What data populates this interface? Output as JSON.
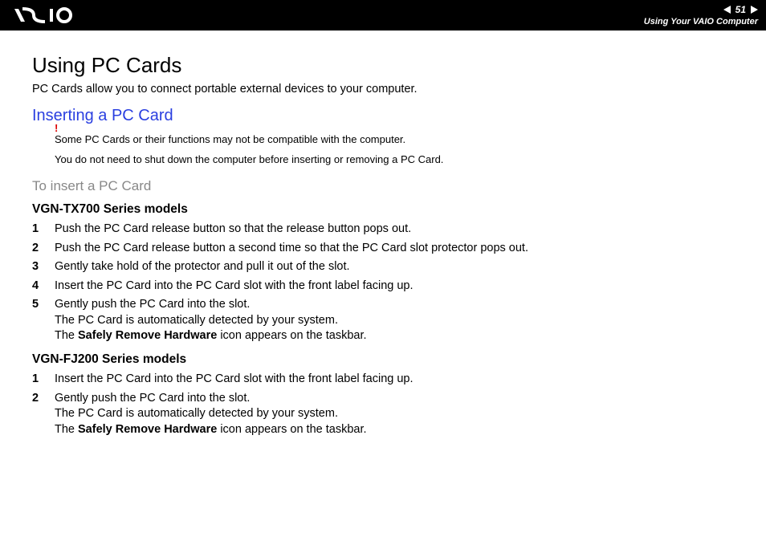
{
  "header": {
    "page_num": "51",
    "section": "Using Your VAIO Computer"
  },
  "title": "Using PC Cards",
  "intro": "PC Cards allow you to connect portable external devices to your computer.",
  "subtitle": "Inserting a PC Card",
  "note1": "Some PC Cards or their functions may not be compatible with the computer.",
  "note2": "You do not need to shut down the computer before inserting or removing a PC Card.",
  "procedure_title": "To insert a PC Card",
  "series1": {
    "name": "VGN-TX700 Series models",
    "steps": [
      "Push the PC Card release button so that the release button pops out.",
      "Push the PC Card release button a second time so that the PC Card slot protector pops out.",
      "Gently take hold of the protector and pull it out of the slot.",
      "Insert the PC Card into the PC Card slot with the front label facing up."
    ],
    "step5_pre": "Gently push the PC Card into the slot.",
    "step5_line2": "The PC Card is automatically detected by your system.",
    "step5_line3a": "The ",
    "step5_bold": "Safely Remove Hardware",
    "step5_line3b": " icon appears on the taskbar."
  },
  "series2": {
    "name": "VGN-FJ200 Series models",
    "step1": "Insert the PC Card into the PC Card slot with the front label facing up.",
    "step2_pre": "Gently push the PC Card into the slot.",
    "step2_line2": "The PC Card is automatically detected by your system.",
    "step2_line3a": "The ",
    "step2_bold": "Safely Remove Hardware",
    "step2_line3b": " icon appears on the taskbar."
  }
}
